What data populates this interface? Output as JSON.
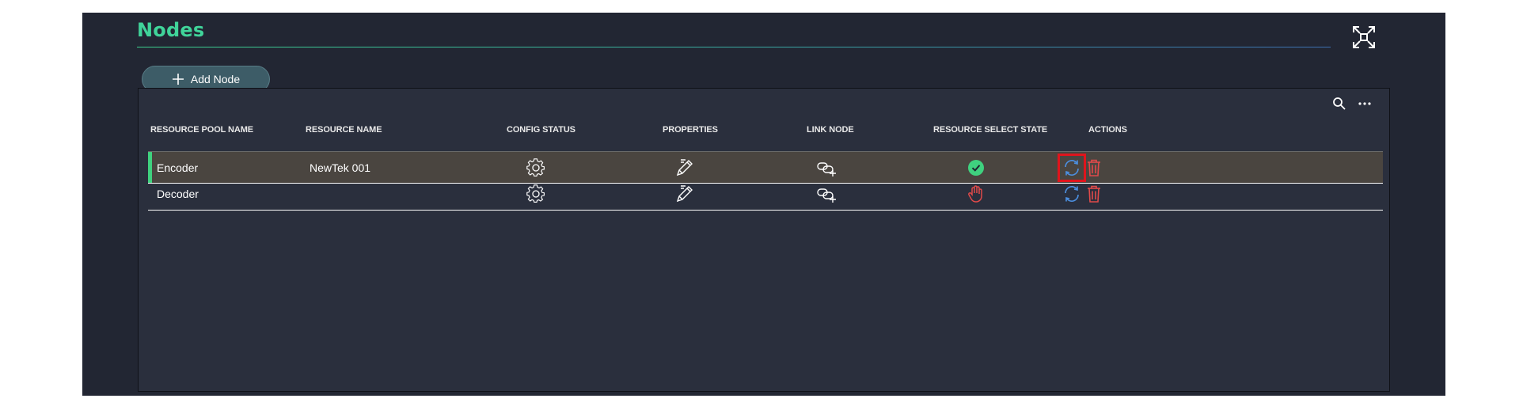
{
  "page": {
    "title": "Nodes"
  },
  "toolbar": {
    "add_label": "Add Node"
  },
  "table": {
    "headers": {
      "pool": "RESOURCE POOL NAME",
      "resource": "RESOURCE NAME",
      "config": "CONFIG STATUS",
      "properties": "PROPERTIES",
      "link": "LINK NODE",
      "select_state": "RESOURCE SELECT STATE",
      "actions": "ACTIONS"
    },
    "rows": [
      {
        "pool": "Encoder",
        "resource": "NewTek 001",
        "select_state": "selected",
        "selected": true
      },
      {
        "pool": "Decoder",
        "resource": "",
        "select_state": "stopped",
        "selected": false
      }
    ]
  },
  "icons": {
    "fullscreen": "expand-icon",
    "search": "search-icon",
    "more": "more-horizontal-icon",
    "config": "gear-icon",
    "properties": "pencil-icon",
    "link": "link-icon",
    "selected_state": "check-circle-icon",
    "stopped_state": "hand-icon",
    "refresh": "refresh-icon",
    "delete": "trash-icon"
  },
  "colors": {
    "accent_green": "#40d49a",
    "background": "#222633",
    "panel": "#2a2f3d",
    "selected_row": "#4a4540",
    "danger": "#e04a4a",
    "refresh_blue": "#4c8fe0",
    "highlight_red": "#e0141c"
  }
}
